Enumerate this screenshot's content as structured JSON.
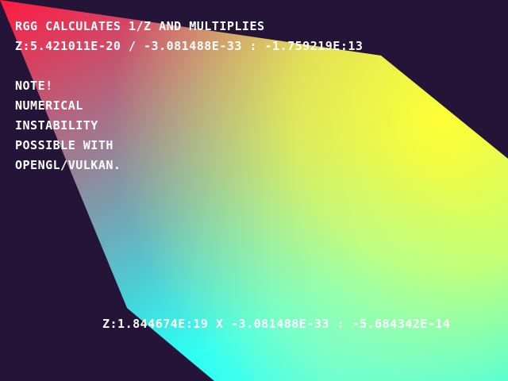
{
  "header": {
    "line1": "RGG calculates 1/Z and multiplies",
    "line2": "Z:5.421011e-20 / -3.081488e-33 : -1.759219e:13"
  },
  "note": {
    "title": "NOTE!",
    "lines": [
      "Numerical",
      "instability",
      "possible with",
      "OpenGL/Vulkan."
    ]
  },
  "footer": {
    "result": "Z:1.844674e:19 x -3.081488e-33 : -5.684342e-14"
  },
  "colors": {
    "background": "#241438",
    "red": "#ff1a40",
    "yellow": "#ffff33",
    "cyan": "#1affff"
  }
}
